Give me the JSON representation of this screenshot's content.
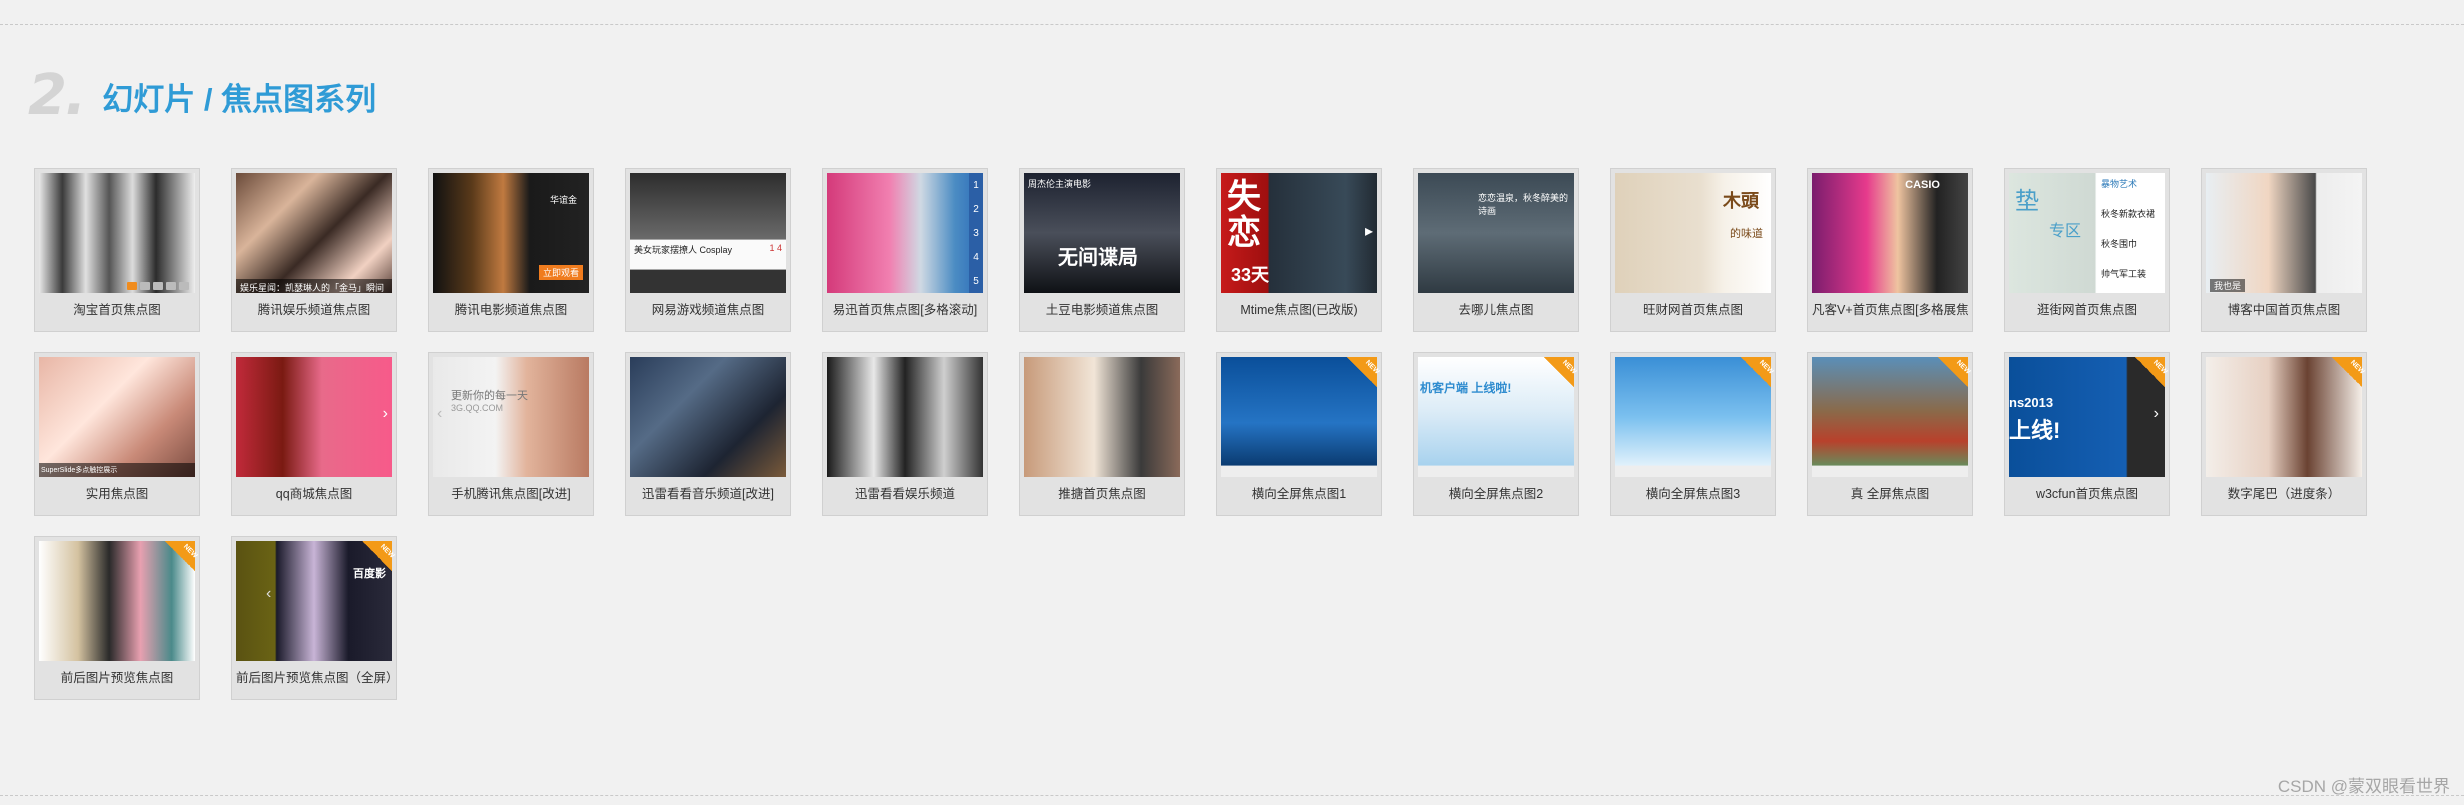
{
  "section": {
    "number": "2.",
    "title": "幻灯片 / 焦点图系列"
  },
  "items": [
    {
      "caption": "淘宝首页焦点图",
      "is_new": false
    },
    {
      "caption": "腾讯娱乐频道焦点图",
      "is_new": false
    },
    {
      "caption": "腾讯电影频道焦点图",
      "is_new": false
    },
    {
      "caption": "网易游戏频道焦点图",
      "is_new": false
    },
    {
      "caption": "易迅首页焦点图[多格滚动]",
      "is_new": false
    },
    {
      "caption": "土豆电影频道焦点图",
      "is_new": false
    },
    {
      "caption": "Mtime焦点图(已改版)",
      "is_new": false
    },
    {
      "caption": "去哪儿焦点图",
      "is_new": false
    },
    {
      "caption": "旺财网首页焦点图",
      "is_new": false
    },
    {
      "caption": "凡客V+首页焦点图[多格展焦]",
      "is_new": false
    },
    {
      "caption": "逛街网首页焦点图",
      "is_new": false
    },
    {
      "caption": "博客中国首页焦点图",
      "is_new": false
    },
    {
      "caption": "实用焦点图",
      "is_new": false
    },
    {
      "caption": "qq商城焦点图",
      "is_new": false
    },
    {
      "caption": "手机腾讯焦点图[改进]",
      "is_new": false
    },
    {
      "caption": "迅雷看看音乐频道[改进]",
      "is_new": false
    },
    {
      "caption": "迅雷看看娱乐频道",
      "is_new": false
    },
    {
      "caption": "推搪首页焦点图",
      "is_new": false
    },
    {
      "caption": "横向全屏焦点图1",
      "is_new": true
    },
    {
      "caption": "横向全屏焦点图2",
      "is_new": true
    },
    {
      "caption": "横向全屏焦点图3",
      "is_new": true
    },
    {
      "caption": "真 全屏焦点图",
      "is_new": true
    },
    {
      "caption": "w3cfun首页焦点图",
      "is_new": true
    },
    {
      "caption": "数字尾巴（进度条）",
      "is_new": true
    },
    {
      "caption": "前后图片预览焦点图",
      "is_new": true
    },
    {
      "caption": "前后图片预览焦点图（全屏）",
      "is_new": true
    }
  ],
  "thumb_text": {
    "t2_bar": "娱乐星闻：凯瑟琳人的「金马」瞬间",
    "t3_side": "华谊金",
    "t3_btn": "立即观看",
    "t4_label": "美女玩家摆撩人 Cosplay",
    "t4_num": "1 4",
    "t5_n1": "1",
    "t5_n2": "2",
    "t5_n3": "3",
    "t5_n4": "4",
    "t5_n5": "5",
    "t6_title": "无间谍局",
    "t6_top": "周杰伦主演电影",
    "t7_big1": "失",
    "t7_big2": "恋",
    "t7_days": "33天",
    "t8_text": "恋恋温泉，秋冬醉美的诗画",
    "t9_title": "木頭",
    "t9_sub": "的味道",
    "t10_brand": "CASIO",
    "t11_l1": "垫",
    "t11_l2": "专区",
    "t11_r1": "暴物艺术",
    "t11_r2": "秋冬新款衣裙",
    "t11_r3": "秋冬围巾",
    "t11_r4": "帅气军工装",
    "t12_label": "我也是",
    "t13_bar": "SuperSlide多点触控展示",
    "t15_text": "更新你的每一天",
    "t15_url": "3G.QQ.COM",
    "t20_text": "机客户端 上线啦!",
    "t23_text": "ns2013",
    "t23_sub": "上线!",
    "t26_text": "百度影"
  },
  "watermark": "CSDN @蒙双眼看世界",
  "colors": {
    "background": "#f1f1f1",
    "section_number": "#d4d4d4",
    "section_title": "#2f9bd6",
    "new_badge": "#f39a17",
    "caption_text": "#333333"
  },
  "icons": {
    "new_badge": "corner-ribbon-new",
    "arrow_left": "chevron-left-icon",
    "arrow_right": "chevron-right-icon"
  }
}
